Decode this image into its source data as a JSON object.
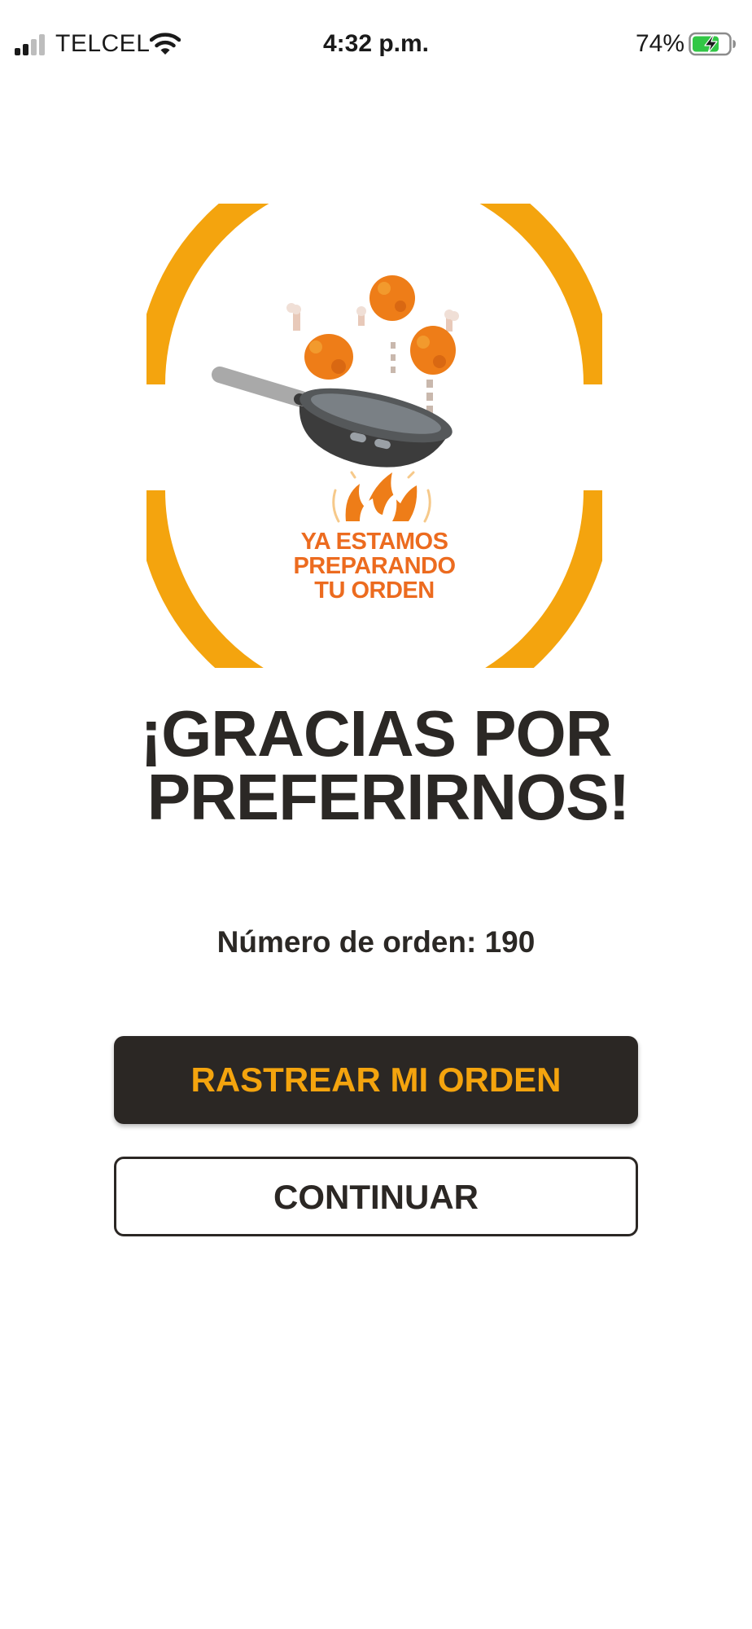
{
  "status_bar": {
    "carrier": "TELCEL",
    "time": "4:32 p.m.",
    "battery_percent": "74%",
    "battery_level": 0.74,
    "icons": [
      "signal-icon",
      "wifi-icon",
      "battery-charging-icon"
    ]
  },
  "hero": {
    "badge_lines": [
      "YA ESTAMOS",
      "PREPARANDO",
      "TU ORDEN"
    ]
  },
  "headline": {
    "line1": "¡GRACIAS POR",
    "line2": "PREFERIRNOS!"
  },
  "order": {
    "label": "Número de orden: 190"
  },
  "buttons": {
    "track_label": "RASTREAR MI ORDEN",
    "continue_label": "CONTINUAR"
  },
  "colors": {
    "accent_orange": "#f4a40e",
    "text_orange": "#ec6b1f",
    "dark": "#2b2724",
    "battery_green": "#32c745"
  }
}
